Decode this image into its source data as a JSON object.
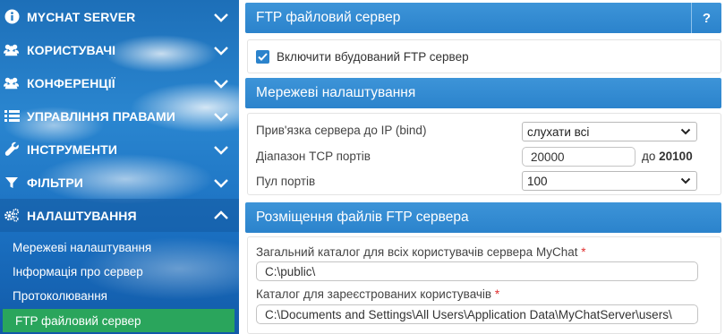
{
  "sidebar": {
    "items": [
      {
        "label": "MYCHAT SERVER",
        "icon": "info-icon"
      },
      {
        "label": "КОРИСТУВАЧІ",
        "icon": "users-icon"
      },
      {
        "label": "КОНФЕРЕНЦІЇ",
        "icon": "conference-icon"
      },
      {
        "label": "УПРАВЛІННЯ ПРАВАМИ",
        "icon": "list-icon"
      },
      {
        "label": "ІНСТРУМЕНТИ",
        "icon": "wrench-icon"
      },
      {
        "label": "ФІЛЬТРИ",
        "icon": "filter-icon"
      },
      {
        "label": "НАЛАШТУВАННЯ",
        "icon": "gears-icon"
      }
    ],
    "subitems": [
      {
        "label": "Мережеві налаштування"
      },
      {
        "label": "Інформація про сервер"
      },
      {
        "label": "Протоколювання"
      },
      {
        "label": "FTP файловий сервер"
      }
    ],
    "active_color": "#2aa55c"
  },
  "main": {
    "title": "FTP файловий сервер",
    "help_label": "?",
    "enable_checkbox": {
      "label": "Включити вбудований FTP сервер",
      "checked": true
    },
    "network": {
      "title": "Мережеві налаштування",
      "bind_label": "Прив'язка сервера до IP (bind)",
      "bind_value": "слухати всі",
      "tcp_label": "Діапазон TCP портів",
      "tcp_from": "20000",
      "tcp_to_prefix": "до",
      "tcp_to": "20100",
      "pool_label": "Пул портів",
      "pool_value": "100"
    },
    "files": {
      "title": "Розміщення файлів FTP сервера",
      "common_label": "Загальний каталог для всіх користувачів сервера MyChat",
      "common_required": "*",
      "common_value": "C:\\public\\",
      "registered_label": "Каталог для зареєстрованих користувачів",
      "registered_required": "*",
      "registered_value": "C:\\Documents and Settings\\All Users\\Application Data\\MyChatServer\\users\\"
    },
    "accent_color": "#2b83cc"
  }
}
